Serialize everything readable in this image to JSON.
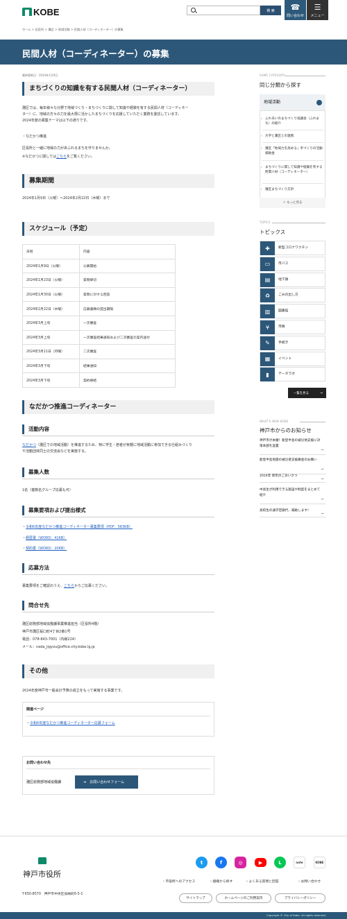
{
  "header": {
    "logo_text": "KOBE",
    "search_button": "検 索",
    "contact_label": "問い合わせ",
    "menu_label": "メニュー"
  },
  "breadcrumb": "ホーム > 区役所 > 灘区 > 地域活動 > 民間人材（コーディネーター）の募集",
  "page_title": "民間人材（コーディネーター）の募集",
  "updated": "最終更新日：2024年1月9日",
  "main": {
    "h2_intro": "まちづくりの知識を有する民間人材（コーディネーター）",
    "intro_lines": [
      "灘区では、毎年様々な分野で地域づくり・まちづくりに関して知識や経験を有する民間人材（コーディネー",
      "ター）に、地域の方々の力を最大限に活かしたまちづくりを応援していただく業務を委託しています。",
      "2024年度の募集テーマは以下の通りです。"
    ],
    "theme_bullet": "・なだかつ推進",
    "intro2": "区役所と一緒に地域の力があふれるまちを作りませんか。",
    "intro3_pre": "※なだかつに関しては",
    "intro3_link": "こちら",
    "intro3_post": "をご覧ください。",
    "h2_period": "募集期間",
    "period": "2024年1月9日（火曜）～2024年2月22日（木曜）まで",
    "h2_schedule": "スケジュール（予定）",
    "schedule": [
      [
        "日程",
        "内容"
      ],
      [
        "2024年1月9日（火曜）",
        "公募開始"
      ],
      [
        "2024年1月23日（火曜）",
        "質問締切"
      ],
      [
        "2024年1月30日（火曜）",
        "質問に対する回答"
      ],
      [
        "2024年2月22日（木曜）",
        "応募書類の提出期限"
      ],
      [
        "2024年3月上旬",
        "一次審査"
      ],
      [
        "2024年3月上旬",
        "一次審査結果通知および二次審査の案内送付"
      ],
      [
        "2024年3月11日（月曜）",
        "二次審査"
      ],
      [
        "2024年3月下旬",
        "結果通知"
      ],
      [
        "2024年3月下旬",
        "契約締結"
      ]
    ],
    "h2_nadakatsu": "なだかつ推進コーディネーター",
    "h3_activity": "活動内容",
    "activity_link": "なだかつ",
    "activity_line1": "（灘区での地域活動）を推進するため、特に学生・若者が気軽に地域活動に参加できる仕組みづくり",
    "activity_line2": "や活動団体同士の交流会などを実施する。",
    "h3_count": "募集人数",
    "count": "1名（複数名グループ応募も可）",
    "h3_docs": "募集要項および提出様式",
    "docs": [
      "令和6年度なだかつ推進コーディネーター募集要項（PDF：583KB）",
      "経歴書（WORD：41KB）",
      "契約書（WORD：20KB）"
    ],
    "h3_apply": "応募方法",
    "apply_pre": "募集要項をご確認のうえ、",
    "apply_link": "こちら",
    "apply_post": "からご応募ください。",
    "h3_contact": "問合せ先",
    "contact_lines": [
      "灘区総務部地域協働課事業推進担当（区役所4階）",
      "神戸市灘区桜口町4丁目2番1号",
      "電話：078-843-7001（内線224）",
      "メール：nada_jigyou@office.city.kobe.lg.jp"
    ],
    "h2_other": "その他",
    "other": "2024年度神戸市一般会計予算の成立をもって実施する事業です。",
    "related_title": "関連ページ",
    "related_link": "令和6年度なだかつ推進コーディネーター応募フォーム",
    "inquiry_title": "お問い合わせ先",
    "inquiry_dept": "灘区総務部地域協働課",
    "inquiry_button": "お問い合わせフォーム"
  },
  "sidebar": {
    "same_cat_label": "SAME CATEGORY",
    "same_cat_title": "同じ分類から探す",
    "area_head": "地域活動",
    "area_links": [
      "ふれあいのまちづくり協議会（ふれまち）の紹介",
      "大学と灘区との連携",
      "灘区「地域力を高める」手づくりの活動補助金",
      "まちづくりに関して知識や経験を有する民間人材（コーディネーター）",
      "灘区まちづくり方針"
    ],
    "area_more": "＋ もっと見る",
    "topics_label": "TOPICS",
    "topics_title": "トピックス",
    "topics": [
      "新型コロナワクチン",
      "市バス",
      "地下鉄",
      "ごみの出し方",
      "図書館",
      "市税",
      "手続き",
      "イベント",
      "データラボ"
    ],
    "topics_icons": [
      "✚",
      "▭",
      "▤",
      "♻",
      "▥",
      "¥",
      "✎",
      "▦",
      "▮"
    ],
    "topics_more": "一覧を見る",
    "news_label": "WHAT'S NEW KOBE",
    "news_title": "神戸市からのお知らせ",
    "news": [
      "神戸市が本腰！能登半島の被災地支援に対策本部を設置",
      "能登半島地震の被災者支援募金のお願い",
      "2024年 新年のごあいさつ",
      "中高生が利用できる施設や制度をまとめて紹介",
      "高校生の通学定期代、補助します！"
    ]
  },
  "footer": {
    "city_name": "神戸市役所",
    "address": "〒650-8570　神戸市中央区加納町6-5-1",
    "social": [
      "twitter-icon",
      "facebook-icon",
      "instagram-icon",
      "youtube-icon",
      "line-icon",
      "note-icon",
      "kobe-icon"
    ],
    "links": [
      "市役所へのアクセス",
      "組織から探す",
      "よくある質問と回答",
      "お問い合わせ"
    ],
    "buttons": [
      "サイトマップ",
      "ホームページのご利用案内",
      "プライバシーポリシー"
    ],
    "copyright": "Copyright © City of Kobe. All rights reserved."
  },
  "colors": {
    "brand": "#2c5779",
    "logo_green": "#0d8a6a"
  }
}
